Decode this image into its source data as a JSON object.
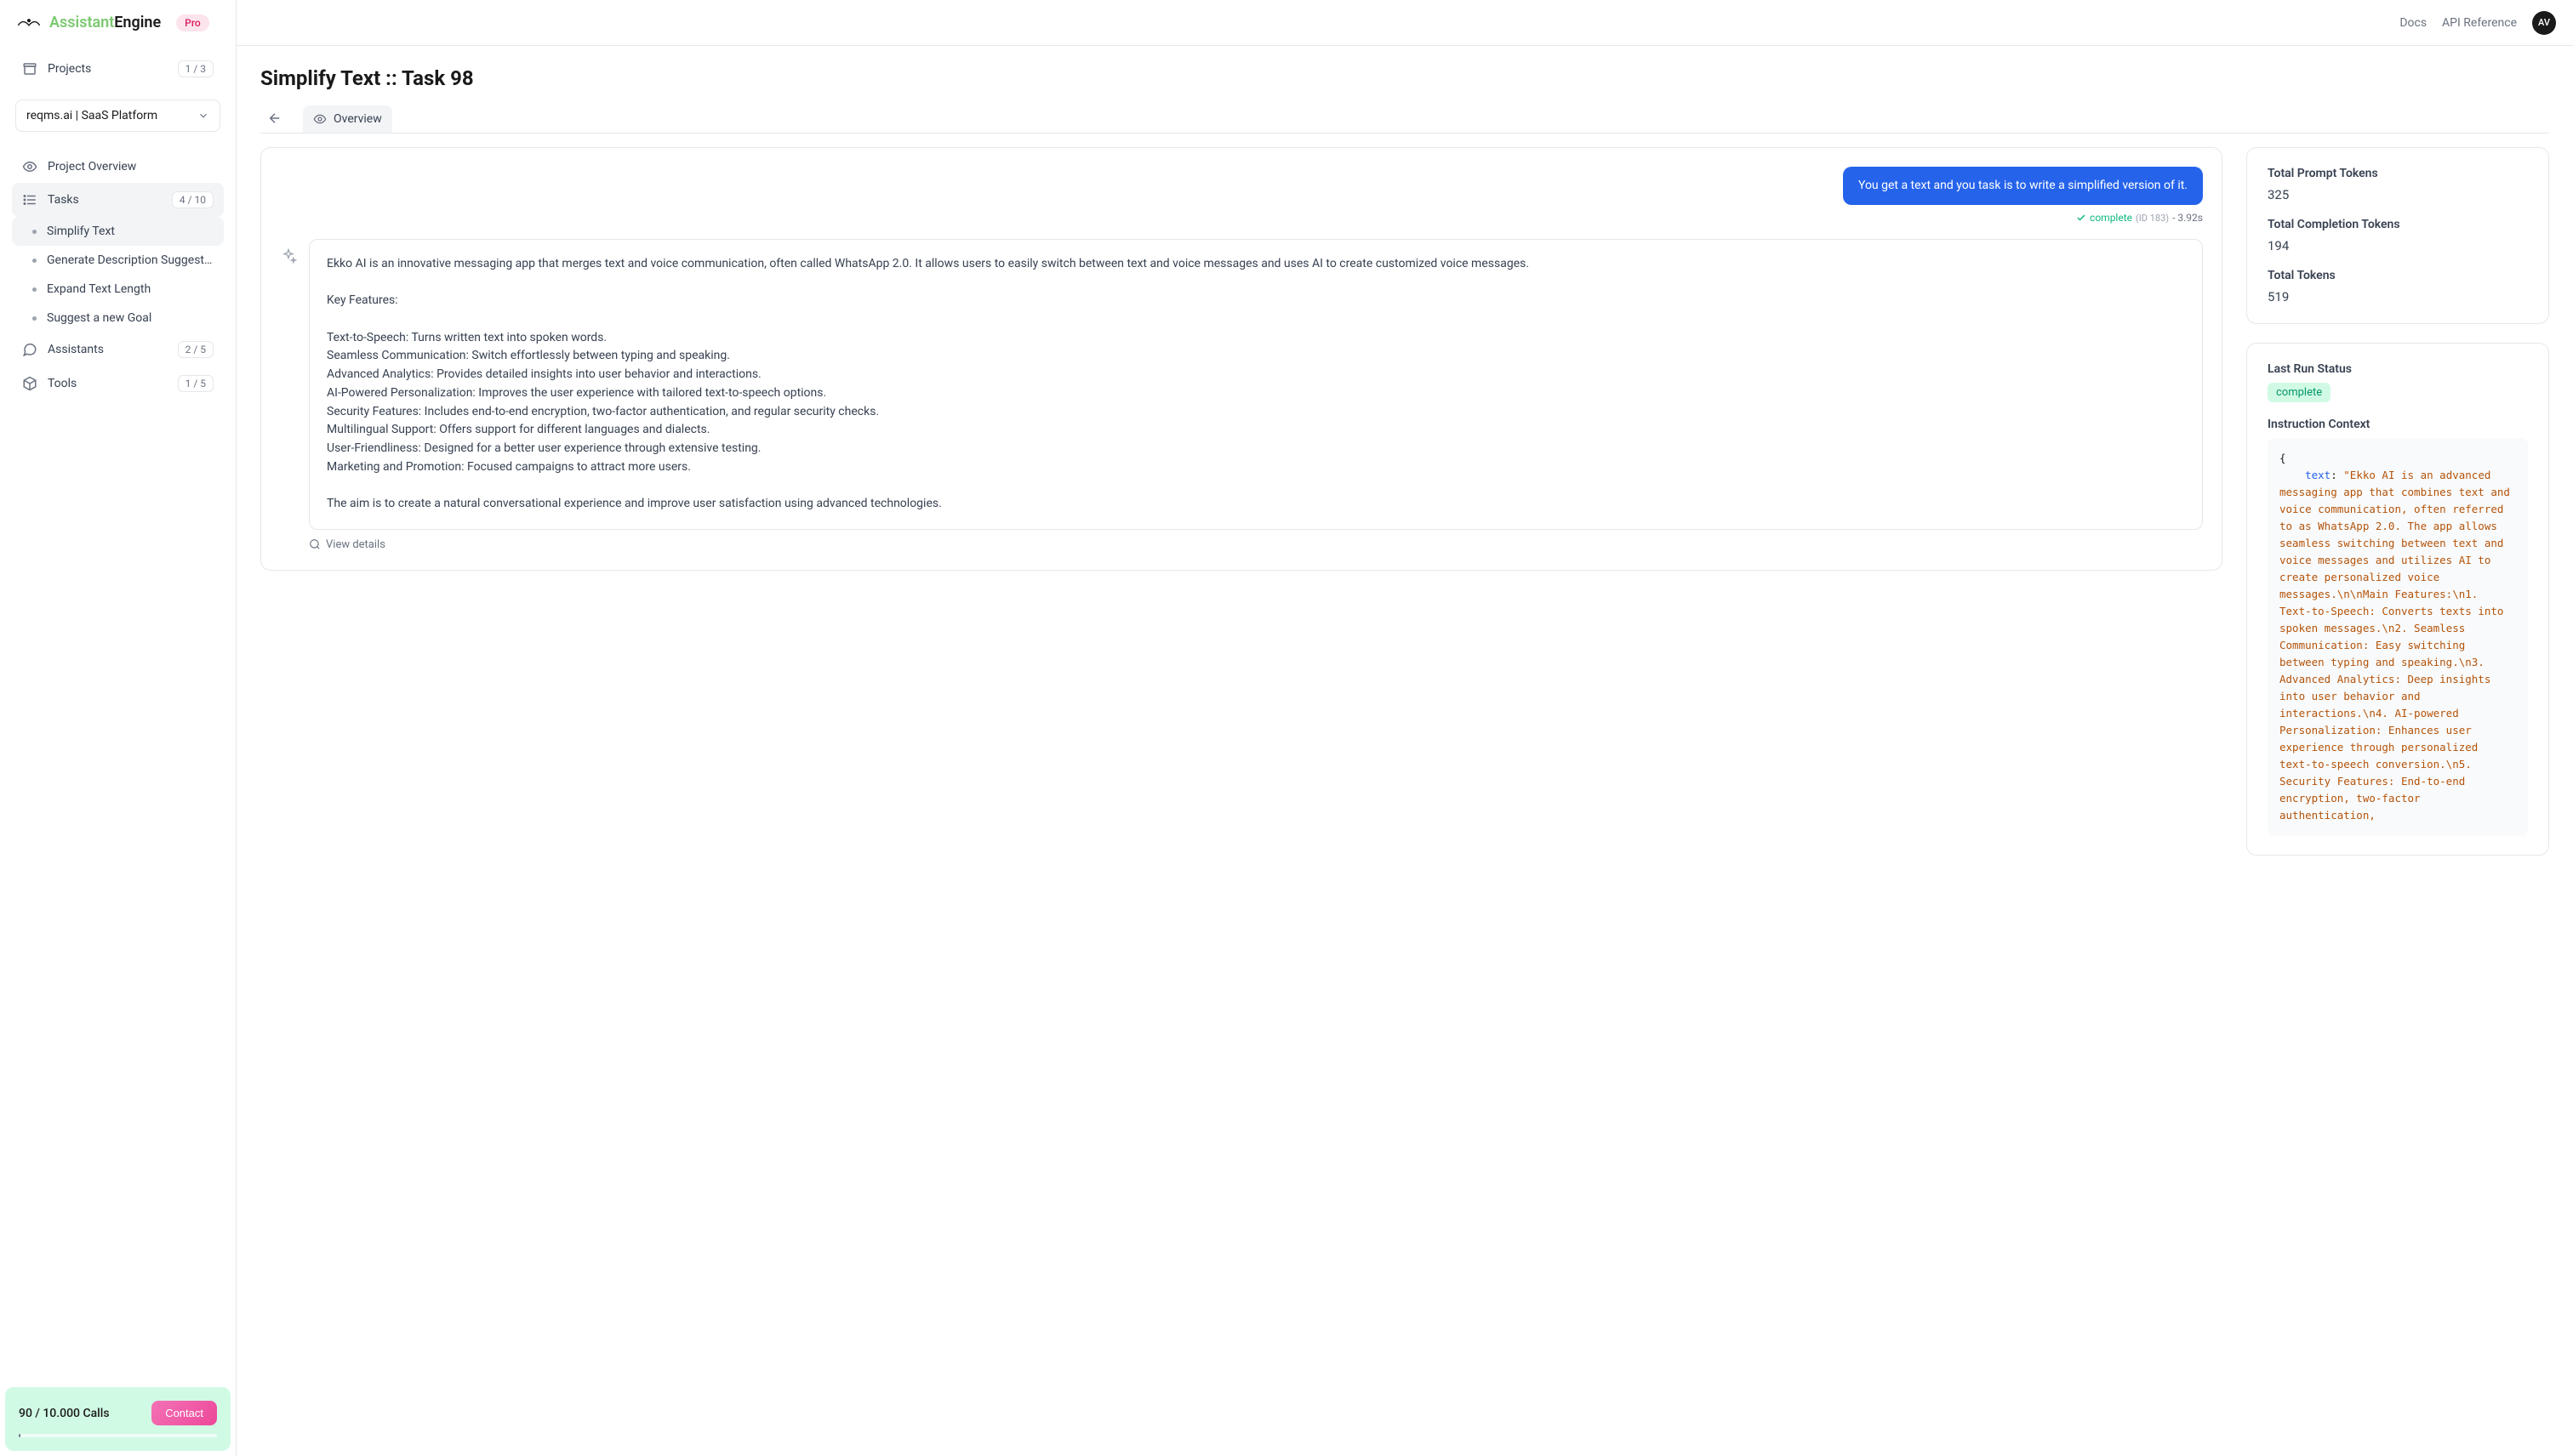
{
  "brand": {
    "name1": "Assistant",
    "name2": "Engine",
    "badge": "Pro"
  },
  "topnav": {
    "docs": "Docs",
    "api": "API Reference",
    "avatar": "AV"
  },
  "sidebar": {
    "projects": {
      "label": "Projects",
      "count": "1 / 3"
    },
    "selector": "reqms.ai | SaaS Platform",
    "overview": "Project Overview",
    "tasks": {
      "label": "Tasks",
      "count": "4 / 10"
    },
    "taskItems": [
      "Simplify Text",
      "Generate Description Suggestion...",
      "Expand Text Length",
      "Suggest a new Goal"
    ],
    "assistants": {
      "label": "Assistants",
      "count": "2 / 5"
    },
    "tools": {
      "label": "Tools",
      "count": "1 / 5"
    }
  },
  "usage": {
    "text": "90 / 10.000 Calls",
    "button": "Contact"
  },
  "page": {
    "title": "Simplify Text :: Task 98",
    "tab": "Overview"
  },
  "chat": {
    "userMessage": "You get a text and you task is to write a simplified version of it.",
    "status": {
      "label": "complete",
      "id": "(ID 183)",
      "time": "- 3.92s"
    },
    "assistantMessage": "Ekko AI is an innovative messaging app that merges text and voice communication, often called WhatsApp 2.0. It allows users to easily switch between text and voice messages and uses AI to create customized voice messages.\n\nKey Features:\n\nText-to-Speech: Turns written text into spoken words.\nSeamless Communication: Switch effortlessly between typing and speaking.\nAdvanced Analytics: Provides detailed insights into user behavior and interactions.\nAI-Powered Personalization: Improves the user experience with tailored text-to-speech options.\nSecurity Features: Includes end-to-end encryption, two-factor authentication, and regular security checks.\nMultilingual Support: Offers support for different languages and dialects.\nUser-Friendliness: Designed for a better user experience through extensive testing.\nMarketing and Promotion: Focused campaigns to attract more users.\n\nThe aim is to create a natural conversational experience and improve user satisfaction using advanced technologies.",
    "viewDetails": "View details"
  },
  "metrics": {
    "promptLabel": "Total Prompt Tokens",
    "promptValue": "325",
    "completionLabel": "Total Completion Tokens",
    "completionValue": "194",
    "totalLabel": "Total Tokens",
    "totalValue": "519"
  },
  "runStatus": {
    "label": "Last Run Status",
    "value": "complete",
    "contextLabel": "Instruction Context",
    "codeKey": "text",
    "codeValue": "\"Ekko AI is an advanced messaging app that combines text and voice communication, often referred to as WhatsApp 2.0. The app allows seamless switching between text and voice messages and utilizes AI to create personalized voice messages.\\n\\nMain Features:\\n1. Text-to-Speech: Converts texts into spoken messages.\\n2. Seamless Communication: Easy switching between typing and speaking.\\n3. Advanced Analytics: Deep insights into user behavior and interactions.\\n4. AI-powered Personalization: Enhances user experience through personalized text-to-speech conversion.\\n5. Security Features: End-to-end encryption, two-factor authentication,"
  }
}
